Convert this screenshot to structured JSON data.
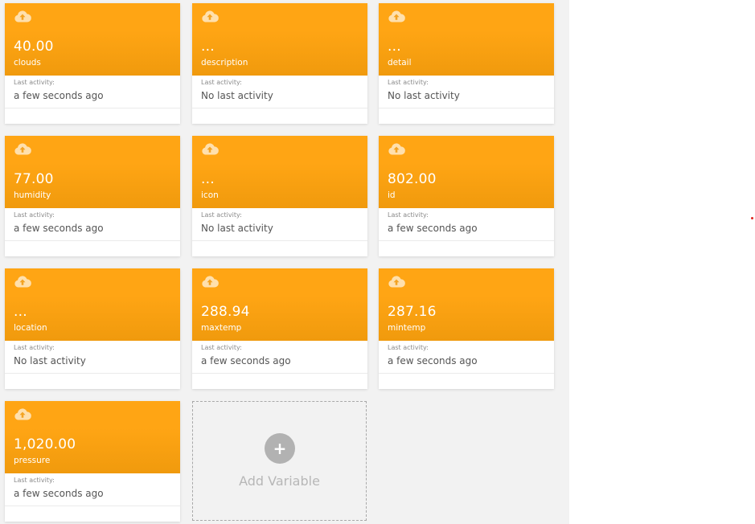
{
  "activity_label": "Last activity:",
  "add_variable": {
    "label": "Add Variable",
    "icon": "plus-icon",
    "symbol": "+"
  },
  "colors": {
    "card_header": "#ffa514",
    "panel_background": "#f2f2f2"
  },
  "variables": [
    {
      "name": "clouds",
      "value": "40.00",
      "last_activity": "a few seconds ago",
      "icon": "cloud-upload-icon"
    },
    {
      "name": "description",
      "value": "...",
      "last_activity": "No last activity",
      "icon": "cloud-upload-icon"
    },
    {
      "name": "detail",
      "value": "...",
      "last_activity": "No last activity",
      "icon": "cloud-upload-icon"
    },
    {
      "name": "humidity",
      "value": "77.00",
      "last_activity": "a few seconds ago",
      "icon": "cloud-upload-icon"
    },
    {
      "name": "icon",
      "value": "...",
      "last_activity": "No last activity",
      "icon": "cloud-upload-icon"
    },
    {
      "name": "id",
      "value": "802.00",
      "last_activity": "a few seconds ago",
      "icon": "cloud-upload-icon"
    },
    {
      "name": "location",
      "value": "...",
      "last_activity": "No last activity",
      "icon": "cloud-upload-icon"
    },
    {
      "name": "maxtemp",
      "value": "288.94",
      "last_activity": "a few seconds ago",
      "icon": "cloud-upload-icon"
    },
    {
      "name": "mintemp",
      "value": "287.16",
      "last_activity": "a few seconds ago",
      "icon": "cloud-upload-icon"
    },
    {
      "name": "pressure",
      "value": "1,020.00",
      "last_activity": "a few seconds ago",
      "icon": "cloud-upload-icon"
    }
  ]
}
